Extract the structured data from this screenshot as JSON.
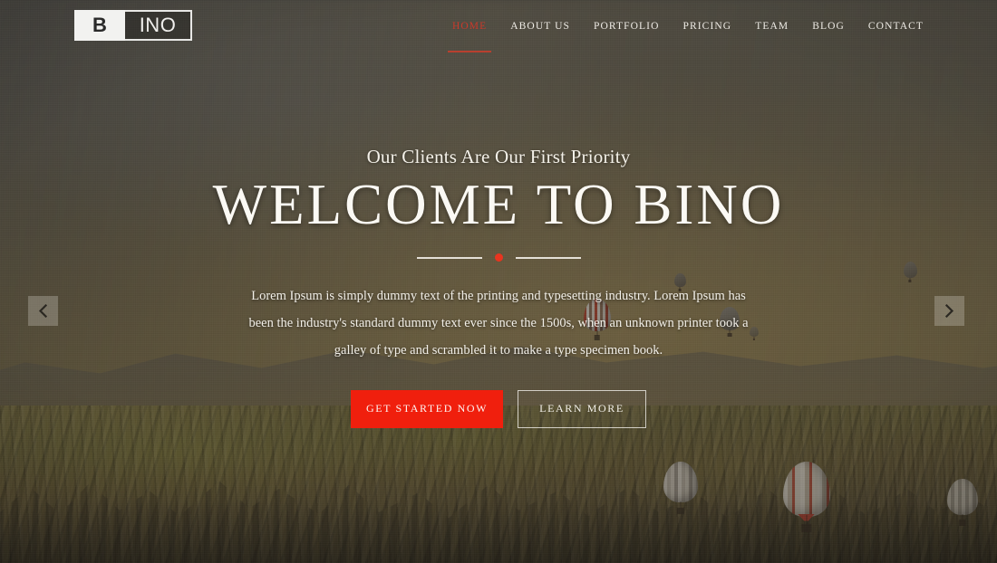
{
  "site": {
    "logo": {
      "primary": "B",
      "secondary": "INO",
      "alt": "BINO"
    }
  },
  "header": {
    "nav": [
      {
        "label": "HOME",
        "name": "nav-item-home",
        "active": true
      },
      {
        "label": "ABOUT US",
        "name": "nav-item-about-us",
        "active": false
      },
      {
        "label": "PORTFOLIO",
        "name": "nav-item-portfolio",
        "active": false
      },
      {
        "label": "PRICING",
        "name": "nav-item-pricing",
        "active": false
      },
      {
        "label": "TEAM",
        "name": "nav-item-team",
        "active": false
      },
      {
        "label": "BLOG",
        "name": "nav-item-blog",
        "active": false
      },
      {
        "label": "CONTACT",
        "name": "nav-item-contact",
        "active": false
      }
    ]
  },
  "hero": {
    "subtitle": "Our Clients Are Our First Priority",
    "title": "WELCOME TO BINO",
    "paragraph": "Lorem Ipsum is simply dummy text of the printing and typesetting industry. Lorem Ipsum has been the industry's standard dummy text ever since the 1500s, when an unknown printer took a galley of type and scrambled it to make a type specimen book.",
    "primary_button": "GET STARTED NOW",
    "secondary_button": "LEARN MORE"
  },
  "slider": {
    "prev_icon": "chevron-left-icon",
    "next_icon": "chevron-right-icon"
  },
  "colors": {
    "accent_red": "#f01f0d",
    "nav_active_red": "#c9392a",
    "divider_dot": "#e8341f",
    "text_light": "#f4f1ea",
    "overlay": "rgba(38,36,32,0.42)"
  }
}
